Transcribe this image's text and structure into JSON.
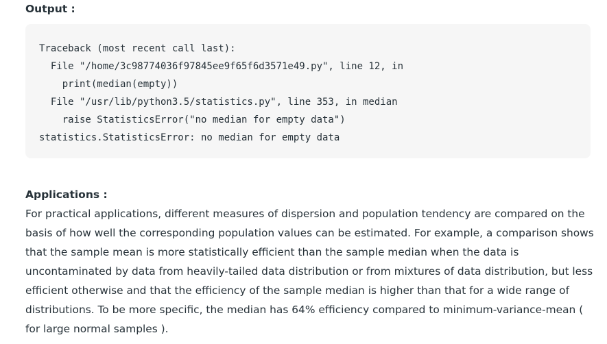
{
  "output_section": {
    "heading": "Output :",
    "code_lines": [
      "Traceback (most recent call last):",
      "  File \"/home/3c98774036f97845ee9f65f6d3571e49.py\", line 12, in",
      "    print(median(empty))",
      "  File \"/usr/lib/python3.5/statistics.py\", line 353, in median",
      "    raise StatisticsError(\"no median for empty data\")",
      "statistics.StatisticsError: no median for empty data"
    ]
  },
  "applications_section": {
    "heading": "Applications :",
    "paragraph_lines": [
      "For practical applications, different measures of dispersion and population tendency are compared on the",
      "basis of how well the corresponding population values can be estimated. For example, a comparison shows",
      "that the sample mean is more statistically efficient than the sample median when the data is",
      "uncontaminated by data from heavily-tailed data distribution or from mixtures of data distribution, but less",
      "efficient otherwise and that the efficiency of the sample median is higher than that for a wide range of",
      "distributions. To be more specific, the median has 64% efficiency compared to minimum-variance-mean (",
      "for large normal samples )."
    ]
  }
}
